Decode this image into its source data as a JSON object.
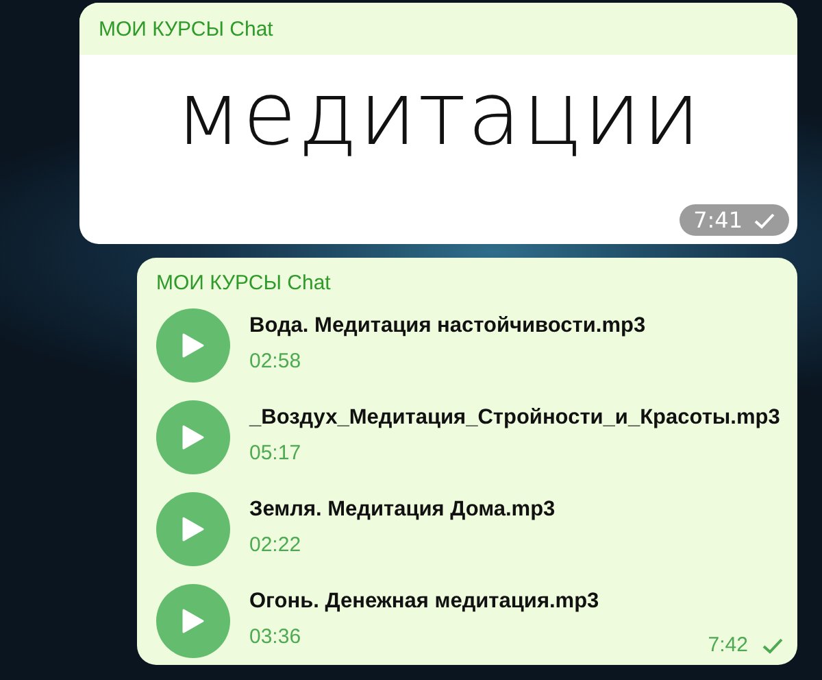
{
  "messages": [
    {
      "kind": "text",
      "sender": "МОИ КУРСЫ Chat",
      "text": "медитации",
      "time": "7:41"
    },
    {
      "kind": "audio",
      "sender": "МОИ КУРСЫ Chat",
      "time": "7:42",
      "files": [
        {
          "title": "Вода. Медитация настойчивости.mp3",
          "duration": "02:58"
        },
        {
          "title": "_Воздух_Медитация_Стройности_и_Красоты.mp3",
          "duration": "05:17"
        },
        {
          "title": "Земля. Медитация Дома.mp3",
          "duration": "02:22"
        },
        {
          "title": "Огонь. Денежная медитация.mp3",
          "duration": "03:36"
        }
      ]
    }
  ]
}
